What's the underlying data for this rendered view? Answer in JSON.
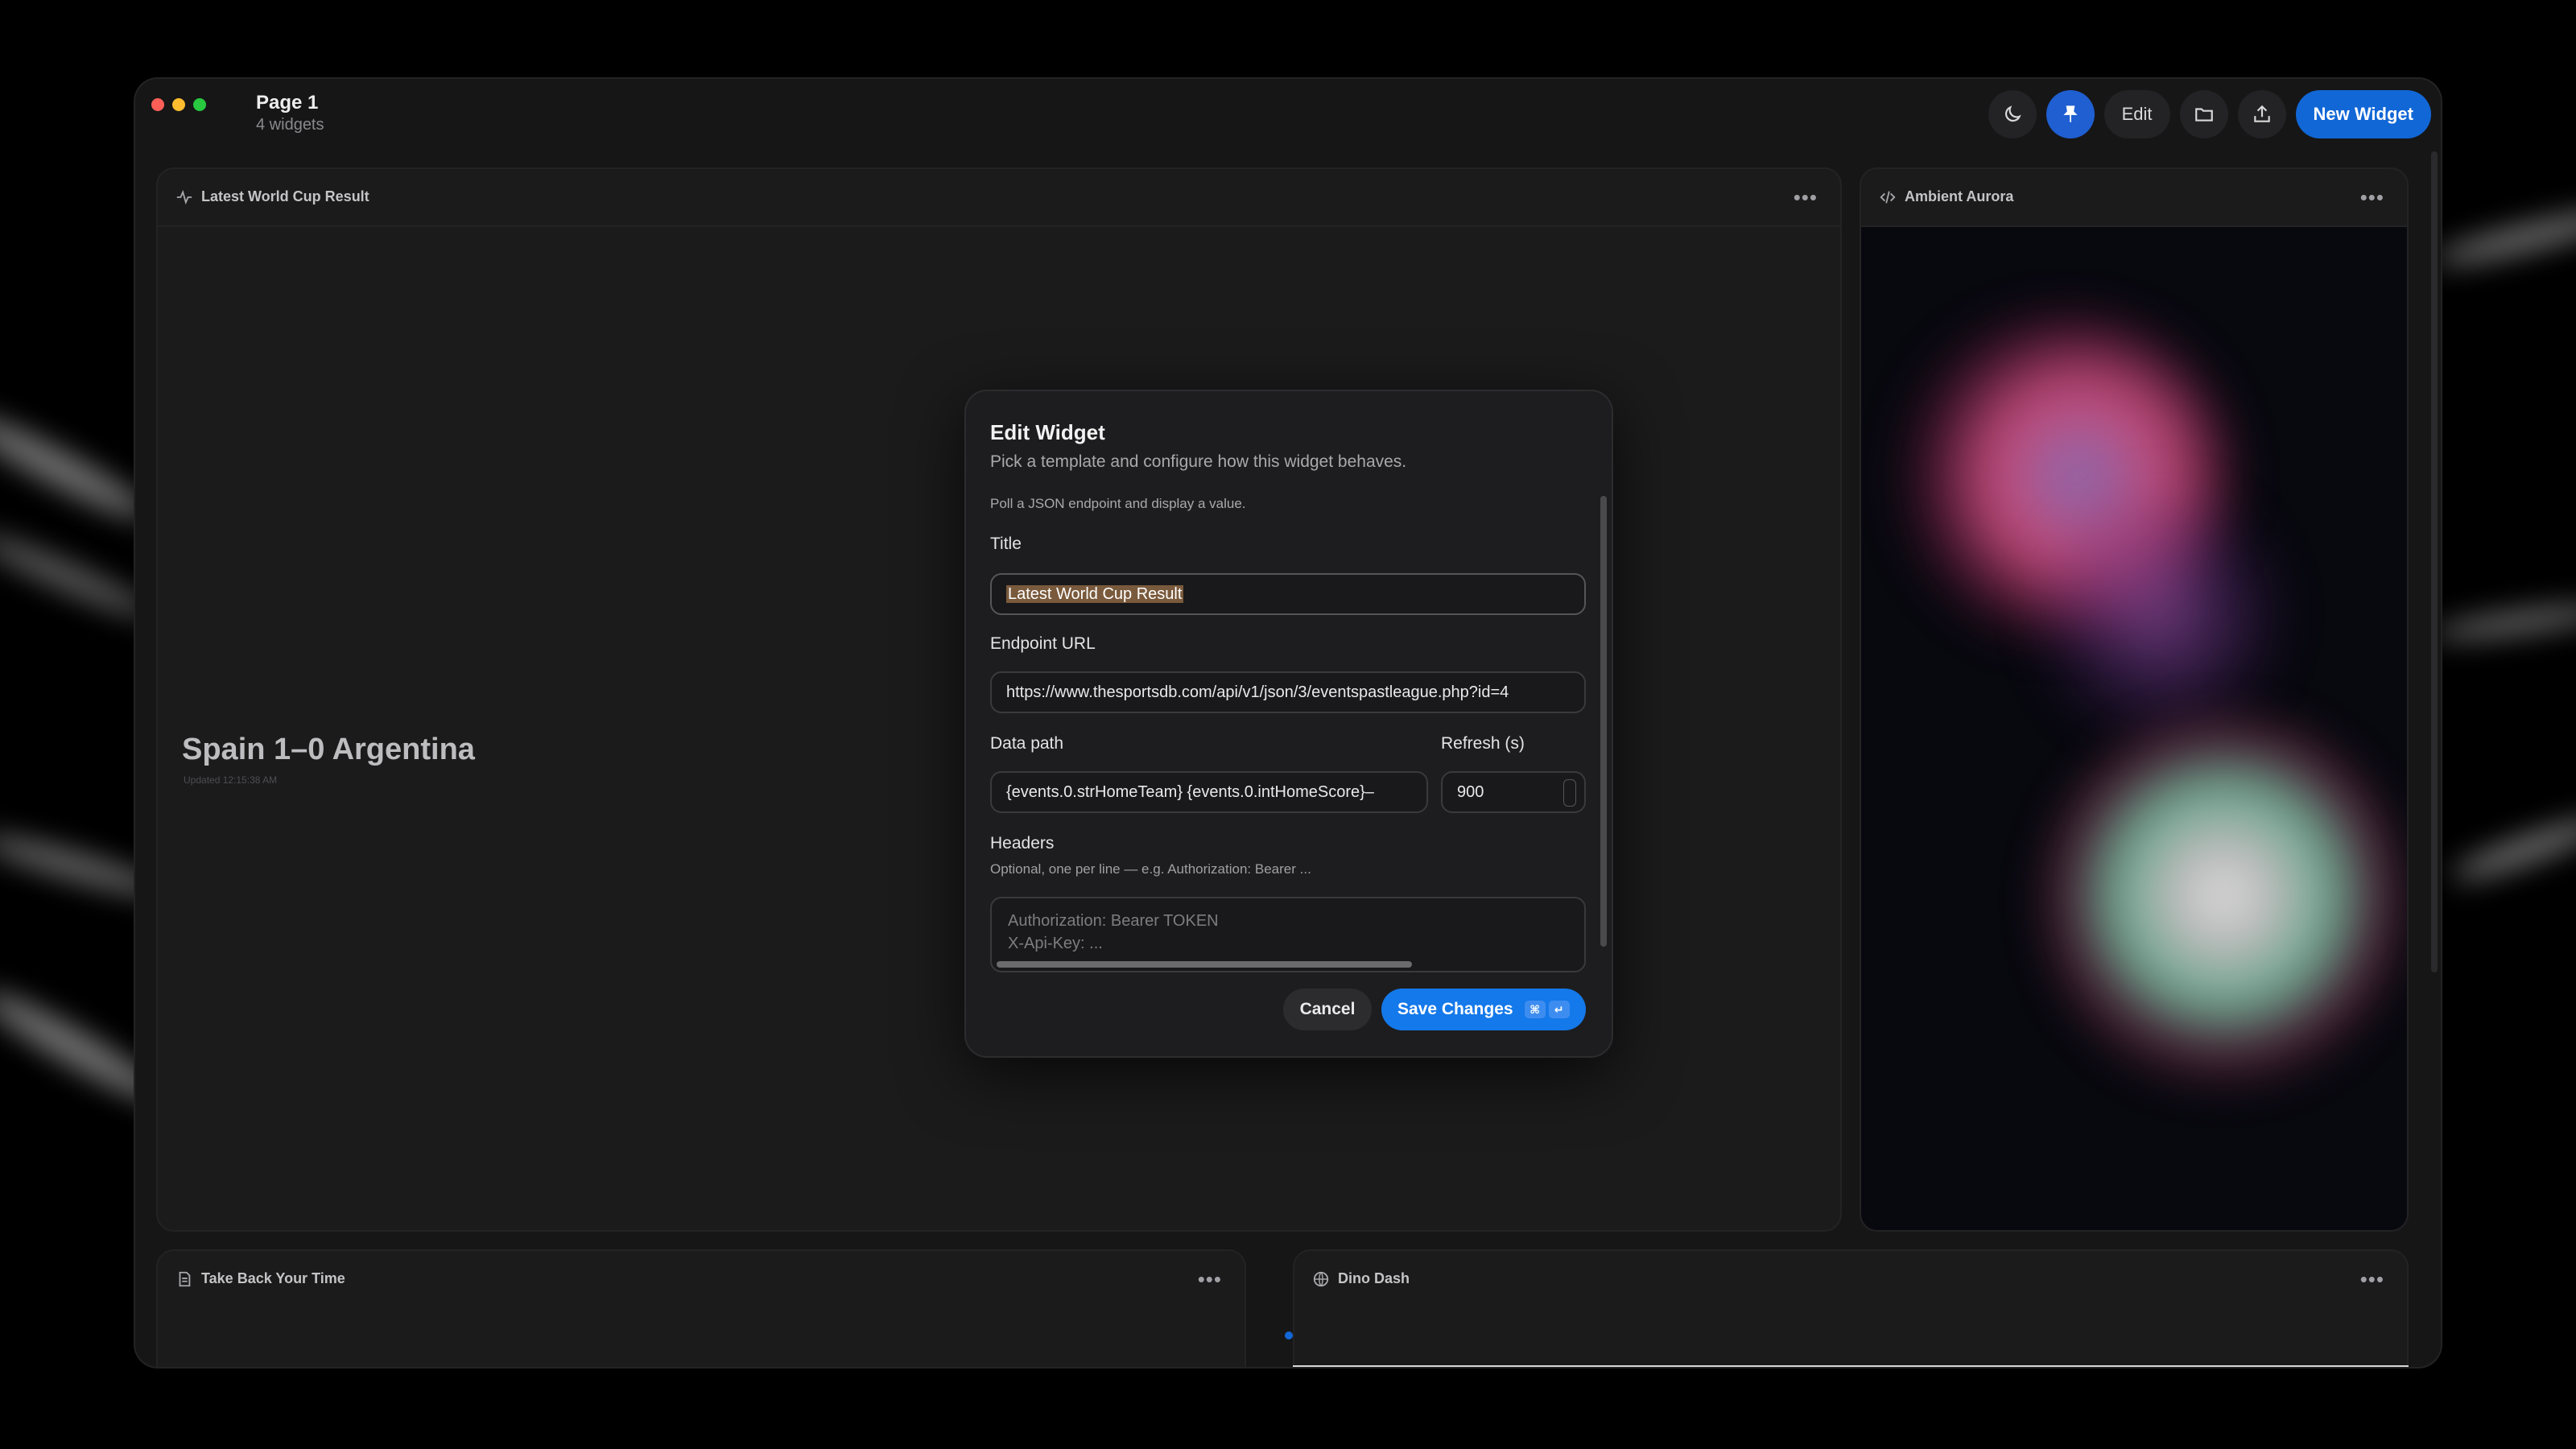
{
  "window": {
    "title": "Page 1",
    "subtitle": "4 widgets"
  },
  "toolbar": {
    "edit_label": "Edit",
    "new_widget_label": "New Widget",
    "icons": [
      "moon-icon",
      "pin-icon",
      "folder-icon",
      "share-icon"
    ]
  },
  "widgets": {
    "main": {
      "title": "Latest World Cup Result",
      "value": "Spain 1–0 Argentina",
      "updated": "Updated 12:15:38 AM"
    },
    "aurora": {
      "title": "Ambient Aurora"
    },
    "time": {
      "title": "Take Back Your Time"
    },
    "dino": {
      "title": "Dino Dash"
    }
  },
  "modal": {
    "title": "Edit Widget",
    "subtitle": "Pick a template and configure how this widget behaves.",
    "note": "Poll a JSON endpoint and display a value.",
    "title_label": "Title",
    "title_value": "Latest World Cup Result",
    "url_label": "Endpoint URL",
    "url_value": "https://www.thesportsdb.com/api/v1/json/3/eventspastleague.php?id=4",
    "path_label": "Data path",
    "path_value": "{events.0.strHomeTeam} {events.0.intHomeScore}–",
    "refresh_label": "Refresh (s)",
    "refresh_value": "900",
    "headers_label": "Headers",
    "headers_help": "Optional, one per line — e.g. Authorization: Bearer ...",
    "headers_placeholder_1": "Authorization: Bearer TOKEN",
    "headers_placeholder_2": "X-Api-Key: ...",
    "cancel_label": "Cancel",
    "save_label": "Save Changes",
    "save_kbd_1": "⌘",
    "save_kbd_2": "↵"
  },
  "colors": {
    "accent": "#1479ea",
    "background": "#161617",
    "panel": "#1b1b1c"
  }
}
